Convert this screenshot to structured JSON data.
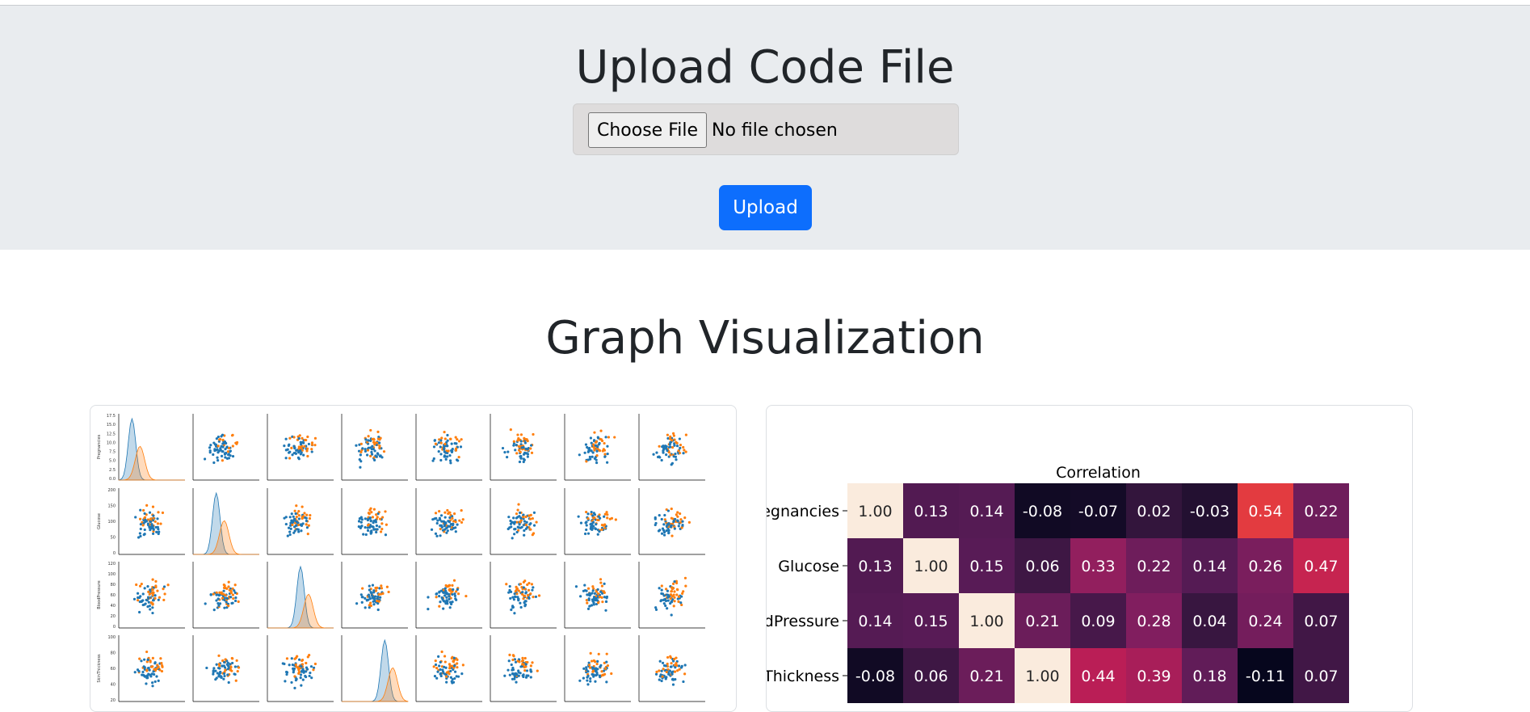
{
  "upload": {
    "title": "Upload Code File",
    "choose_label": "Choose File",
    "no_file_text": "No file chosen",
    "upload_label": "Upload"
  },
  "visualization": {
    "title": "Graph Visualization"
  },
  "colors": {
    "accent": "#0d6efd",
    "hero_bg": "#e9ecef",
    "series_a": "#1f77b4",
    "series_b": "#ff7f0e"
  },
  "pairplot": {
    "row_labels": [
      "Pregnancies",
      "Glucose",
      "BloodPressure",
      "SkinThickness"
    ],
    "pregnancies_ticks": [
      "17.5",
      "15.0",
      "12.5",
      "10.0",
      "7.5",
      "5.0",
      "2.5",
      "0.0"
    ],
    "glucose_ticks": [
      "200",
      "150",
      "100",
      "50",
      "0"
    ],
    "bloodpressure_ticks": [
      "120",
      "100",
      "80",
      "60",
      "40",
      "20",
      "0"
    ],
    "skinthickness_ticks": [
      "100",
      "80",
      "60",
      "40",
      "20"
    ]
  },
  "chart_data": {
    "type": "heatmap",
    "title": "Correlation",
    "row_labels": [
      "egnancies",
      "Glucose",
      "dPressure",
      "Thickness"
    ],
    "values": [
      [
        1.0,
        0.13,
        0.14,
        -0.08,
        -0.07,
        0.02,
        -0.03,
        0.54,
        0.22
      ],
      [
        0.13,
        1.0,
        0.15,
        0.06,
        0.33,
        0.22,
        0.14,
        0.26,
        0.47
      ],
      [
        0.14,
        0.15,
        1.0,
        0.21,
        0.09,
        0.28,
        0.04,
        0.24,
        0.07
      ],
      [
        -0.08,
        0.06,
        0.21,
        1.0,
        0.44,
        0.39,
        0.18,
        -0.11,
        0.07
      ]
    ],
    "value_format": "0.00"
  }
}
